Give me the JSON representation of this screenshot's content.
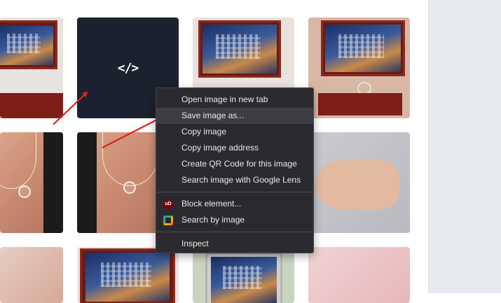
{
  "gallery": {
    "code_placeholder_icon": "code-icon",
    "placeholder_glyph": "</>"
  },
  "context_menu": {
    "items": [
      {
        "label": "Open image in new tab"
      },
      {
        "label": "Save image as..."
      },
      {
        "label": "Copy image"
      },
      {
        "label": "Copy image address"
      },
      {
        "label": "Create QR Code for this image"
      },
      {
        "label": "Search image with Google Lens"
      },
      {
        "label": "Block element..."
      },
      {
        "label": "Search by image"
      },
      {
        "label": "Inspect"
      }
    ],
    "highlighted_item": "Save image as...",
    "extension_icons": {
      "block_element": "ublock-origin-icon",
      "search_by_image": "search-by-image-icon"
    },
    "ublock_icon_text": "uD"
  },
  "annotations": {
    "arrow_color": "#e0201c"
  },
  "colors": {
    "menu_bg": "#2b2b2f",
    "menu_highlight": "#3d3e43",
    "sidebar_bg": "#e6e9ee"
  }
}
